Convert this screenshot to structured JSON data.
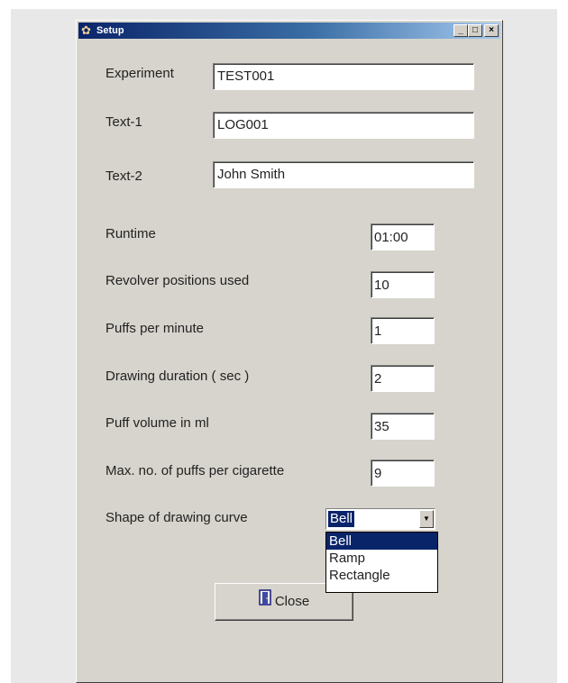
{
  "window": {
    "title": "Setup",
    "minimize": "_",
    "maximize": "□",
    "close": "×"
  },
  "fields": {
    "experiment": {
      "label": "Experiment",
      "value": "TEST001"
    },
    "text1": {
      "label": "Text-1",
      "value": "LOG001"
    },
    "text2": {
      "label": "Text-2",
      "value": "John Smith"
    },
    "runtime": {
      "label": "Runtime",
      "value": "01:00"
    },
    "revolver": {
      "label": "Revolver positions used",
      "value": "10"
    },
    "puffs_per_minute": {
      "label": "Puffs per minute",
      "value": "1"
    },
    "drawing_duration": {
      "label": "Drawing duration ( sec )",
      "value": "2"
    },
    "puff_volume": {
      "label": "Puff volume in ml",
      "value": "35"
    },
    "max_puffs": {
      "label": "Max. no. of puffs per cigarette",
      "value": "9"
    },
    "curve_shape": {
      "label": "Shape of drawing curve",
      "value": "Bell",
      "options": [
        "Bell",
        "Ramp",
        "Rectangle"
      ]
    }
  },
  "buttons": {
    "close_label": "Close"
  },
  "icons": {
    "app": "app-icon",
    "close": "door-icon"
  }
}
